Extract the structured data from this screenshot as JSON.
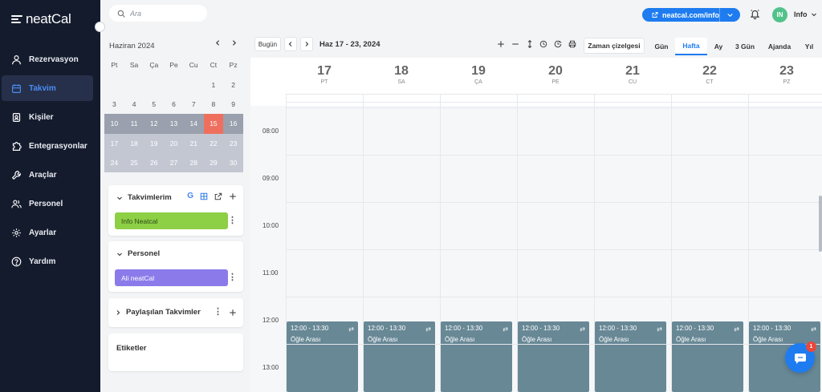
{
  "app": {
    "brand": "neatCal"
  },
  "sidebar": {
    "items": [
      {
        "label": "Rezervasyon",
        "icon": "user-icon"
      },
      {
        "label": "Takvim",
        "icon": "calendar-icon",
        "active": true
      },
      {
        "label": "Kişiler",
        "icon": "contacts-icon"
      },
      {
        "label": "Entegrasyonlar",
        "icon": "puzzle-icon"
      },
      {
        "label": "Araçlar",
        "icon": "wrench-icon"
      },
      {
        "label": "Personel",
        "icon": "users-icon"
      },
      {
        "label": "Ayarlar",
        "icon": "gear-icon"
      },
      {
        "label": "Yardım",
        "icon": "help-icon"
      }
    ]
  },
  "topbar": {
    "search_placeholder": "Ara",
    "url_button": "neatcal.com/info",
    "avatar_initials": "IN",
    "user_name": "Info"
  },
  "mini_calendar": {
    "title": "Haziran 2024",
    "weekdays": [
      "Pt",
      "Sa",
      "Ça",
      "Pe",
      "Cu",
      "Ct",
      "Pz"
    ],
    "weeks": [
      [
        "",
        "",
        "",
        "",
        "",
        "1",
        "2"
      ],
      [
        "3",
        "4",
        "5",
        "6",
        "7",
        "8",
        "9"
      ],
      [
        "10",
        "11",
        "12",
        "13",
        "14",
        "15",
        "16"
      ],
      [
        "17",
        "18",
        "19",
        "20",
        "21",
        "22",
        "23"
      ],
      [
        "24",
        "25",
        "26",
        "27",
        "28",
        "29",
        "30"
      ]
    ],
    "today": "15"
  },
  "calendars_card": {
    "title": "Takvimlerim",
    "item": "Info Neatcal"
  },
  "staff_card": {
    "title": "Personel",
    "item": "Ali neatCal"
  },
  "shared_card": {
    "title": "Paylaşılan Takvimler"
  },
  "tags_card": {
    "title": "Etiketler"
  },
  "toolbar": {
    "today": "Bugün",
    "range": "Haz 17 - 23, 2024",
    "timeline": "Zaman çizelgesi",
    "views": [
      "Gün",
      "Hafta",
      "Ay",
      "3 Gün",
      "Ajanda",
      "Yıl"
    ],
    "active_view": "Hafta"
  },
  "week": {
    "days": [
      {
        "num": "17",
        "name": "PT"
      },
      {
        "num": "18",
        "name": "SA"
      },
      {
        "num": "19",
        "name": "ÇA"
      },
      {
        "num": "20",
        "name": "PE"
      },
      {
        "num": "21",
        "name": "CU"
      },
      {
        "num": "22",
        "name": "CT"
      },
      {
        "num": "23",
        "name": "PZ"
      }
    ],
    "times": [
      "08:00",
      "09:00",
      "10:00",
      "11:00",
      "12:00",
      "13:00"
    ],
    "event": {
      "time": "12:00 - 13:30",
      "title": "Öğle Arası"
    }
  },
  "chat": {
    "badge": "1"
  },
  "colors": {
    "sidebar_bg": "#141b2d",
    "accent": "#1e7cf0",
    "today": "#ef6f5e",
    "calendar_green": "#8dcf45",
    "staff_purple": "#8b7bea",
    "event": "#688896"
  }
}
